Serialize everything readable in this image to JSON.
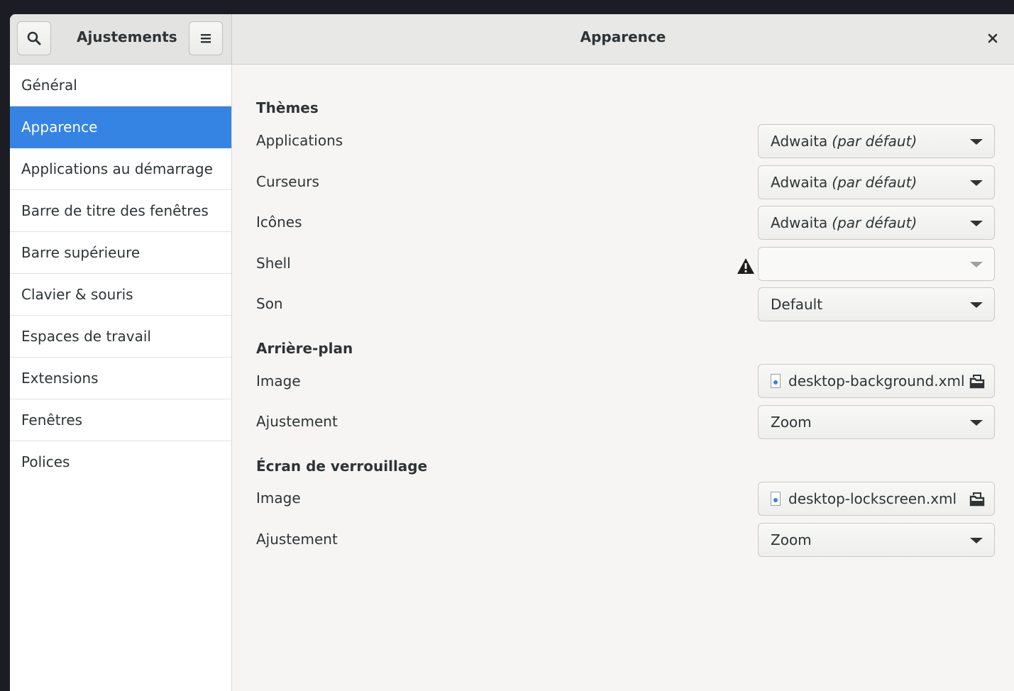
{
  "header": {
    "app_title": "Ajustements",
    "page_title": "Apparence",
    "search_icon": "search-icon",
    "menu_icon": "hamburger-menu-icon",
    "close_icon": "close-icon",
    "close_glyph": "✕"
  },
  "sidebar": {
    "items": [
      {
        "label": "Général"
      },
      {
        "label": "Apparence",
        "active": true
      },
      {
        "label": "Applications au démarrage"
      },
      {
        "label": "Barre de titre des fenêtres"
      },
      {
        "label": "Barre supérieure"
      },
      {
        "label": "Clavier & souris"
      },
      {
        "label": "Espaces de travail"
      },
      {
        "label": "Extensions"
      },
      {
        "label": "Fenêtres"
      },
      {
        "label": "Polices"
      }
    ]
  },
  "content": {
    "themes": {
      "title": "Thèmes",
      "applications": {
        "label": "Applications",
        "value": "Adwaita",
        "suffix": "(par défaut)"
      },
      "cursors": {
        "label": "Curseurs",
        "value": "Adwaita",
        "suffix": "(par défaut)"
      },
      "icons": {
        "label": "Icônes",
        "value": "Adwaita",
        "suffix": "(par défaut)"
      },
      "shell": {
        "label": "Shell",
        "value": "",
        "warning_icon": "warning-icon"
      },
      "sound": {
        "label": "Son",
        "value": "Default"
      }
    },
    "background": {
      "title": "Arrière-plan",
      "image": {
        "label": "Image",
        "file": "desktop-background.xml"
      },
      "adjustment": {
        "label": "Ajustement",
        "value": "Zoom"
      }
    },
    "lockscreen": {
      "title": "Écran de verrouillage",
      "image": {
        "label": "Image",
        "file": "desktop-lockscreen.xml"
      },
      "adjustment": {
        "label": "Ajustement",
        "value": "Zoom"
      }
    }
  },
  "colors": {
    "accent": "#3584e4",
    "sidebar_bg": "#ffffff",
    "content_bg": "#f6f5f4",
    "headerbar_bg": "#e8e8e7",
    "text": "#2e3436"
  }
}
